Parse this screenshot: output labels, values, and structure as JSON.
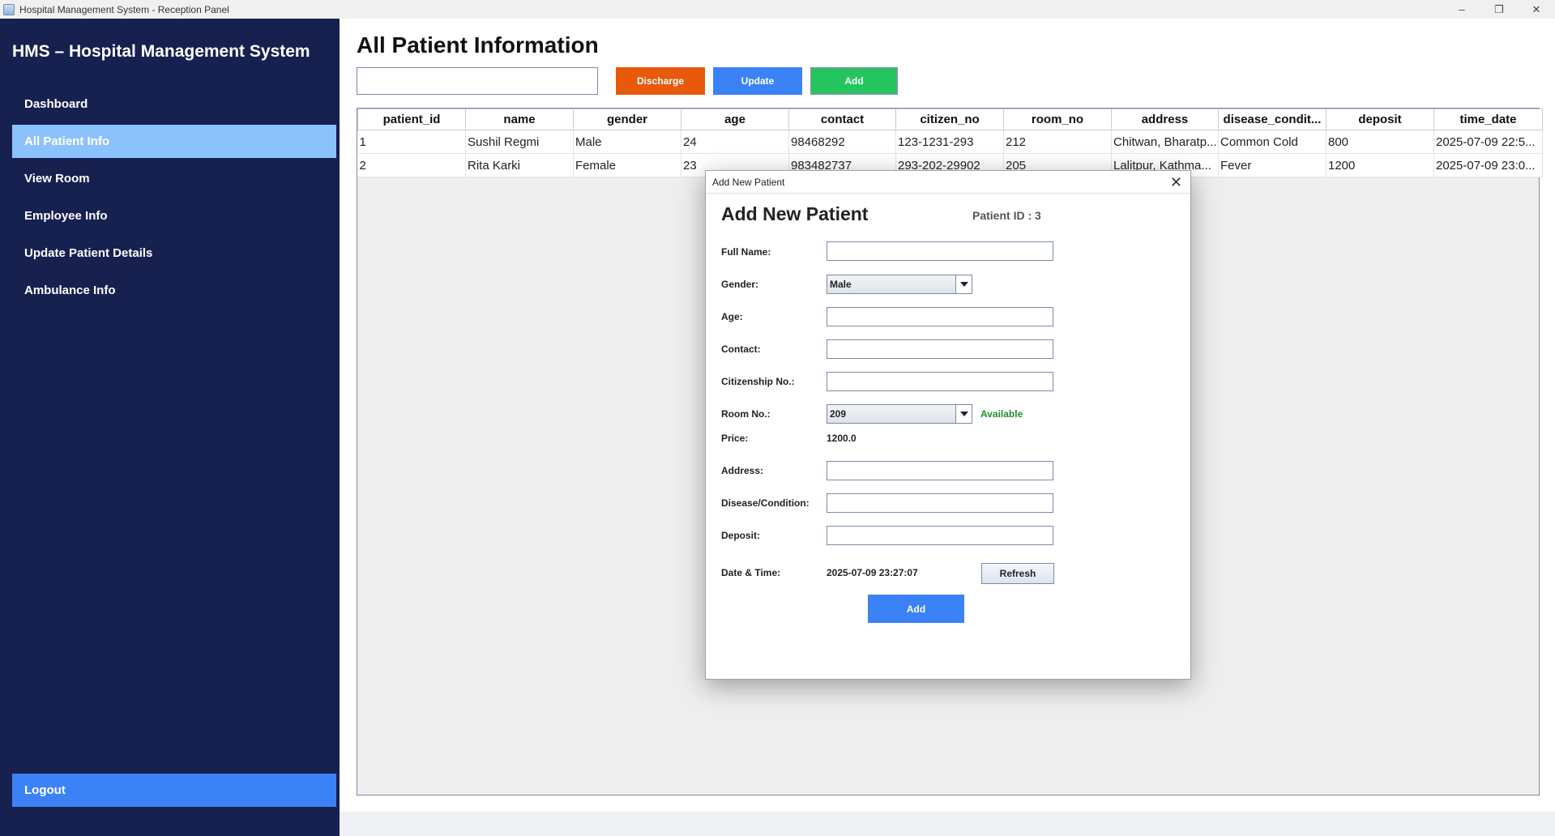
{
  "window": {
    "title": "Hospital Management System - Reception Panel",
    "controls": [
      "–",
      "❐",
      "✕"
    ]
  },
  "sidebar": {
    "brand": "HMS – Hospital Management System",
    "items": [
      {
        "label": "Dashboard"
      },
      {
        "label": "All Patient Info"
      },
      {
        "label": "View Room"
      },
      {
        "label": "Employee Info"
      },
      {
        "label": "Update Patient Details"
      },
      {
        "label": "Ambulance Info"
      }
    ],
    "logout": "Logout"
  },
  "main": {
    "title": "All Patient Information",
    "search_value": "",
    "buttons": {
      "discharge": "Discharge",
      "update": "Update",
      "add": "Add"
    },
    "table": {
      "columns": [
        "patient_id",
        "name",
        "gender",
        "age",
        "contact",
        "citizen_no",
        "room_no",
        "address",
        "disease_condit...",
        "deposit",
        "time_date"
      ],
      "rows": [
        [
          "1",
          "Sushil Regmi",
          "Male",
          "24",
          "98468292",
          "123-1231-293",
          "212",
          "Chitwan, Bharatp...",
          "Common Cold",
          "800",
          "2025-07-09 22:5..."
        ],
        [
          "2",
          "Rita Karki",
          "Female",
          "23",
          "983482737",
          "293-202-29902",
          "205",
          "Lalitpur, Kathma...",
          "Fever",
          "1200",
          "2025-07-09 23:0..."
        ]
      ]
    }
  },
  "dialog": {
    "window_title": "Add New Patient",
    "heading": "Add New Patient",
    "patient_id": "Patient ID : 3",
    "labels": {
      "full_name": "Full Name:",
      "gender": "Gender:",
      "age": "Age:",
      "contact": "Contact:",
      "citizenship": "Citizenship No.:",
      "room": "Room No.:",
      "price": "Price:",
      "address": "Address:",
      "disease": "Disease/Condition:",
      "deposit": "Deposit:",
      "datetime": "Date & Time:"
    },
    "values": {
      "gender": "Male",
      "room": "209",
      "room_status": "Available",
      "price": "1200.0",
      "datetime": "2025-07-09 23:27:07"
    },
    "refresh": "Refresh",
    "add": "Add"
  },
  "colors": {
    "sidebar_bg": "#172150",
    "sidebar_active": "#8cc2fb",
    "discharge": "#e8590c",
    "update": "#3b82f6",
    "add": "#22c55e",
    "available": "#1f8f2a"
  }
}
